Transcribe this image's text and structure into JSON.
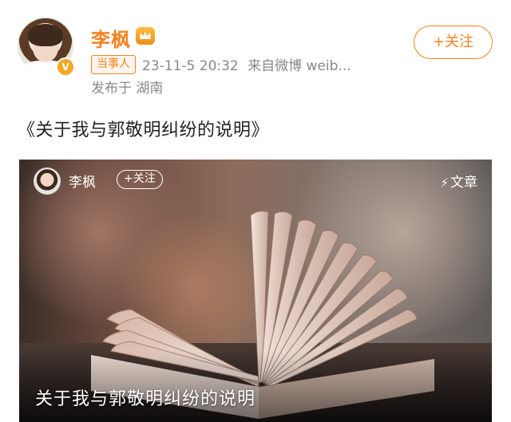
{
  "header": {
    "username": "李枫",
    "vip_badge_icon": "crown-icon",
    "verified_icon": "v-icon",
    "follow_label": "+关注"
  },
  "meta": {
    "tag": "当事人",
    "time": "23-11-5 20:32",
    "source": "来自微博 weib...",
    "location": "发布于 湖南"
  },
  "post": {
    "text": "《关于我与郭敬明纠纷的说明》"
  },
  "card": {
    "author": "李枫",
    "follow_label": "+关注",
    "type_label": "文章",
    "type_icon": "lightning-icon",
    "title": "关于我与郭敬明纠纷的说明"
  },
  "colors": {
    "accent": "#f58220",
    "muted": "#888888"
  }
}
